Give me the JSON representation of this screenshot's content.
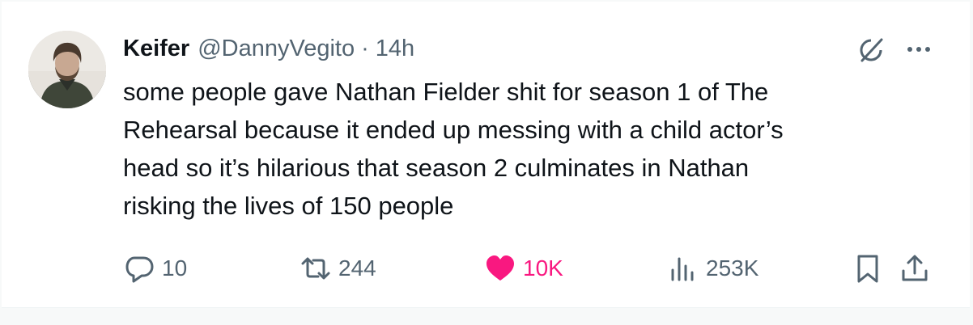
{
  "tweet": {
    "display_name": "Keifer",
    "handle": "@DannyVegito",
    "separator": "·",
    "time": "14h",
    "text": "some people gave Nathan Fielder shit for season 1 of The\nRehearsal because it ended up messing with a child actor’s\nhead so it’s hilarious that season 2 culminates in Nathan\nrisking the lives of 150 people"
  },
  "actions": {
    "replies": "10",
    "reposts": "244",
    "likes": "10K",
    "views": "253K"
  },
  "icons": {
    "grok": "grok-icon",
    "more": "more-icon",
    "reply": "reply-icon",
    "repost": "repost-icon",
    "like": "heart-icon",
    "views": "views-icon",
    "bookmark": "bookmark-icon",
    "share": "share-icon"
  },
  "colors": {
    "text": "#0f1419",
    "secondary": "#536471",
    "like": "#f91880"
  }
}
